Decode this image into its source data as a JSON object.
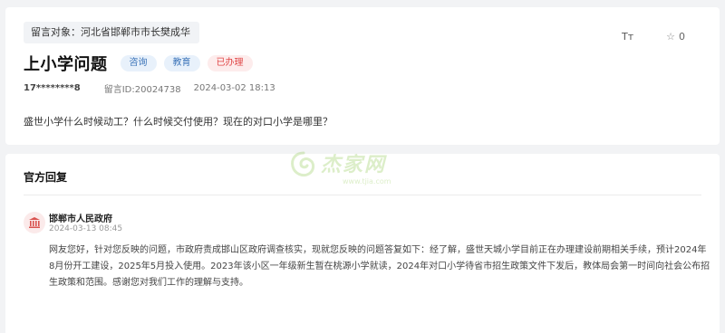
{
  "message": {
    "target_label": "留言对象：河北省邯郸市市长樊成华",
    "title": "上小学问题",
    "tags": {
      "type": "咨询",
      "category": "教育",
      "status": "已办理"
    },
    "user": "17********8",
    "id_label": "留言ID:20024738",
    "datetime": "2024-03-02 18:13",
    "content": "盛世小学什么时候动工？什么时候交付使用？现在的对口小学是哪里？"
  },
  "tools": {
    "font_size_icon": "Tт",
    "favorite_icon": "star-icon",
    "favorite_count": "0"
  },
  "reply": {
    "section_title": "官方回复",
    "org_icon": "government-building-icon",
    "org_name": "邯郸市人民政府",
    "time": "2024-03-13 08:45",
    "body": "网友您好，针对您反映的问题，市政府责成邯山区政府调查核实，现就您反映的问题答复如下：经了解，盛世天城小学目前正在办理建设前期相关手续，预计2024年8月份开工建设，2025年5月投入使用。2023年该小区一年级新生暂在桃源小学就读，2024年对口小学待省市招生政策文件下发后，教体局会第一时间向社会公布招生政策和范围。感谢您对我们工作的理解与支持。"
  },
  "watermark": {
    "text": "杰家网",
    "url": "www.tjia.com"
  },
  "colors": {
    "status_red": "#e04646",
    "tag_blue": "#3a73b8",
    "watermark_green": "#86c440"
  }
}
